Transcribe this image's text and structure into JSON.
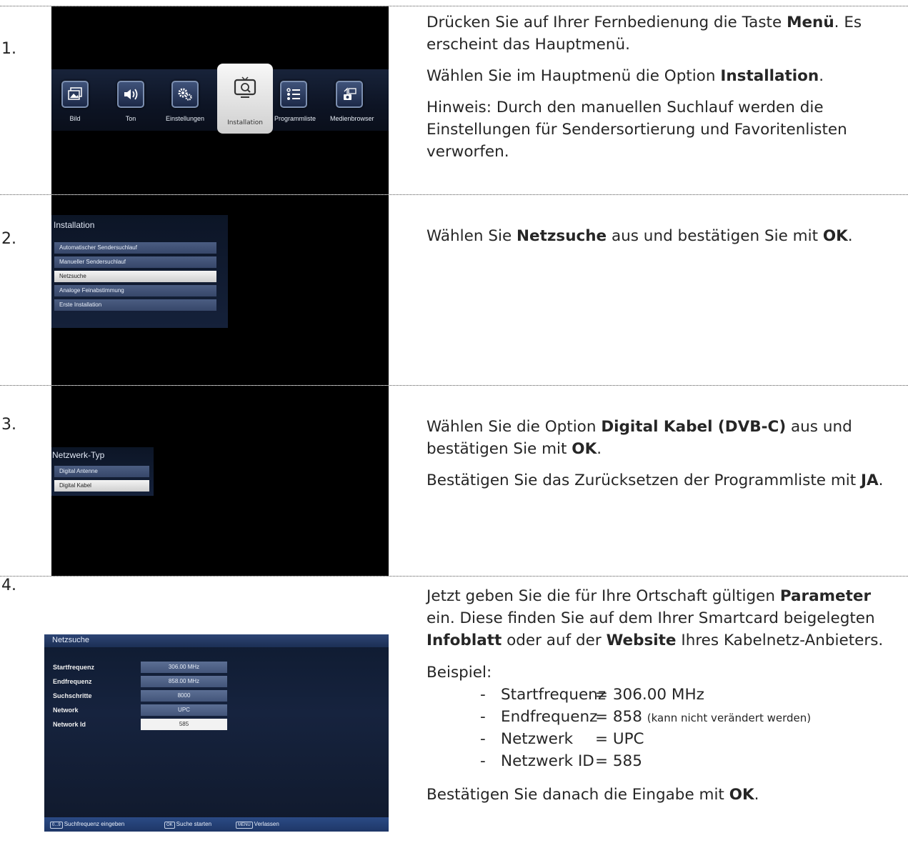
{
  "steps": [
    {
      "number": "1.",
      "paras": [
        {
          "pre": "Drücken Sie auf Ihrer Fernbedienung die Taste ",
          "bold": "Menü",
          "post": ". Es erscheint das Hauptmenü."
        },
        {
          "pre": "Wählen Sie im Hauptmenü die Option ",
          "bold": "Installation",
          "post": "."
        },
        {
          "pre": "Hinweis: Durch den manuellen Suchlauf werden die Einstellungen für Sendersortierung und Favoritenlisten verworfen.",
          "bold": "",
          "post": ""
        }
      ]
    },
    {
      "number": "2.",
      "paras": [
        {
          "pre": "Wählen Sie ",
          "bold": "Netzsuche",
          "mid": " aus und bestätigen Sie mit ",
          "bold2": "OK",
          "post": "."
        }
      ]
    },
    {
      "number": "3.",
      "paras": [
        {
          "pre": "Wählen Sie die Option ",
          "bold": "Digital Kabel (DVB-C)",
          "mid": " aus und bestätigen Sie mit ",
          "bold2": "OK",
          "post": "."
        },
        {
          "pre": "Bestätigen Sie das Zurücksetzen der Programmliste mit ",
          "bold": "JA",
          "post": "."
        }
      ]
    },
    {
      "number": "4.",
      "paras": [
        {
          "pre": "Jetzt geben Sie die für Ihre Ortschaft gültigen ",
          "bold": "Parameter",
          "mid": " ein. Diese finden Sie auf dem Ihrer Smartcard beigelegten ",
          "bold2": "Infoblatt",
          "mid2": " oder auf der ",
          "bold3": "Website",
          "post": " Ihres Kabelnetz-Anbieters."
        }
      ],
      "example_label": "Beispiel:",
      "example": [
        {
          "name": "Startfrequenz",
          "value": "= 306.00 MHz",
          "note": ""
        },
        {
          "name": "Endfrequenz",
          "value": "= 858",
          "note": "(kann nicht verändert werden)"
        },
        {
          "name": "Netzwerk",
          "value": "= UPC",
          "note": ""
        },
        {
          "name": "Netzwerk ID",
          "value": "= 585",
          "note": ""
        }
      ],
      "final_pre": "Bestätigen Sie danach die Eingabe mit ",
      "final_bold": "OK",
      "final_post": "."
    }
  ],
  "tv_main_menu": {
    "items": [
      "Bild",
      "Ton",
      "Einstellungen",
      "Installation",
      "Programmliste",
      "Medienbrowser"
    ],
    "selected": "Installation",
    "icons": [
      "picture-icon",
      "speaker-icon",
      "gears-icon",
      "tv-icon",
      "list-icon",
      "media-icon"
    ]
  },
  "tv_installation": {
    "title": "Installation",
    "items": [
      "Automatischer Sendersuchlauf",
      "Manueller Sendersuchlauf",
      "Netzsuche",
      "Analoge Feinabstimmung",
      "Erste Installation"
    ],
    "selected": "Netzsuche"
  },
  "tv_network_type": {
    "title": "Netzwerk-Typ",
    "items": [
      "Digital Antenne",
      "Digital Kabel"
    ],
    "selected": "Digital Kabel"
  },
  "tv_netzsuche": {
    "title": "Netzsuche",
    "fields": [
      {
        "label": "Startfrequenz",
        "value": "306.00 MHz"
      },
      {
        "label": "Endfrequenz",
        "value": "858.00 MHz"
      },
      {
        "label": "Suchschritte",
        "value": "8000"
      },
      {
        "label": "Network",
        "value": "UPC"
      },
      {
        "label": "Network Id",
        "value": "585"
      }
    ],
    "selected_field": "Network Id",
    "footer": [
      {
        "key": "0...9",
        "label": "Suchfrequenz eingeben"
      },
      {
        "key": "OK",
        "label": "Suche starten"
      },
      {
        "key": "MENU",
        "label": "Verlassen"
      }
    ]
  },
  "colors": {
    "accent_header": "#1e3767",
    "selected_row": "#f2f2f2"
  }
}
